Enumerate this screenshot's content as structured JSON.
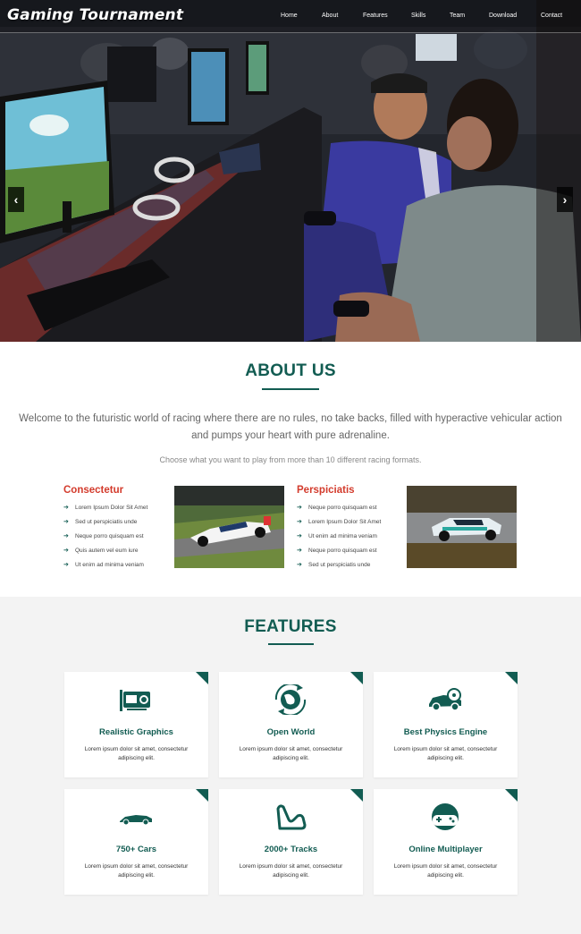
{
  "header": {
    "brand": "Gaming Tournament",
    "nav": [
      "Home",
      "About",
      "Features",
      "Skills",
      "Team",
      "Download",
      "Contact"
    ]
  },
  "hero": {
    "prev_icon": "chevron-left-icon",
    "next_icon": "chevron-right-icon",
    "prev_glyph": "‹",
    "next_glyph": "›"
  },
  "about": {
    "title": "ABOUT US",
    "lead": "Welcome to the futuristic world of racing where there are no rules, no take backs, filled with hyperactive vehicular action and pumps your heart with pure adrenaline.",
    "sub": "Choose what you want to play from more than 10 different racing formats.",
    "columns": [
      {
        "title": "Consectetur",
        "items": [
          "Lorem Ipsum Dolor Sit Amet",
          "Sed ut perspiciatis unde",
          "Neque porro quisquam est",
          "Quis autem vel eum iure",
          "Ut enim ad minima veniam"
        ]
      },
      {
        "title": "Perspiciatis",
        "items": [
          "Neque porro quisquam est",
          "Lorem Ipsum Dolor Sit Amet",
          "Ut enim ad minima veniam",
          "Neque porro quisquam est",
          "Sed ut perspiciatis unde"
        ]
      }
    ]
  },
  "features": {
    "title": "FEATURES",
    "cards": [
      {
        "title": "Realistic Graphics",
        "desc": "Lorem ipsum dolor sit amet, consectetur adipiscing elit.",
        "icon": "graphics-card-icon"
      },
      {
        "title": "Open World",
        "desc": "Lorem ipsum dolor sit amet, consectetur adipiscing elit.",
        "icon": "globe-icon"
      },
      {
        "title": "Best Physics Engine",
        "desc": "Lorem ipsum dolor sit amet, consectetur adipiscing elit.",
        "icon": "car-engine-icon"
      },
      {
        "title": "750+ Cars",
        "desc": "Lorem ipsum dolor sit amet, consectetur adipiscing elit.",
        "icon": "sports-car-icon"
      },
      {
        "title": "2000+ Tracks",
        "desc": "Lorem ipsum dolor sit amet, consectetur adipiscing elit.",
        "icon": "race-track-icon"
      },
      {
        "title": "Online Multiplayer",
        "desc": "Lorem ipsum dolor sit amet, consectetur adipiscing elit.",
        "icon": "gamepad-icon"
      }
    ]
  },
  "colors": {
    "accent": "#125c52",
    "column_title": "#d33b2c",
    "hero_overlay": "#000000"
  }
}
